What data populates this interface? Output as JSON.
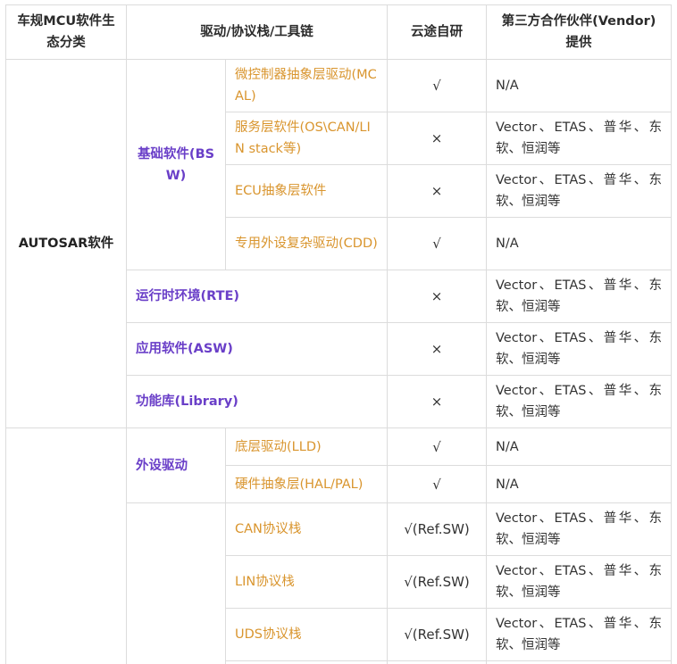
{
  "headers": {
    "category": "车规MCU软件生态分类",
    "driver": "驱动/协议栈/工具链",
    "yuntu": "云途自研",
    "vendor": "第三方合作伙伴(Vendor)提供"
  },
  "autosar": {
    "label": "AUTOSAR软件",
    "bsw": {
      "label": "基础软件(BSW)",
      "rows": [
        {
          "name": "微控制器抽象层驱动(MCAL)",
          "mark": "√",
          "vendor": "N/A"
        },
        {
          "name": "服务层软件(OS\\CAN/LIN stack等)",
          "mark": "×",
          "vendor": "Vector、ETAS、普华、东软、恒润等"
        },
        {
          "name": "ECU抽象层软件",
          "mark": "×",
          "vendor": "Vector、ETAS、普华、东软、恒润等"
        },
        {
          "name": "专用外设复杂驱动(CDD)",
          "mark": "√",
          "vendor": "N/A"
        }
      ]
    },
    "rows": [
      {
        "label": "运行时环境(RTE)",
        "mark": "×",
        "vendor": "Vector、ETAS、普华、东软、恒润等"
      },
      {
        "label": "应用软件(ASW)",
        "mark": "×",
        "vendor": "Vector、ETAS、普华、东软、恒润等"
      },
      {
        "label": "功能库(Library)",
        "mark": "×",
        "vendor": "Vector、ETAS、普华、东软、恒润等"
      }
    ]
  },
  "other": {
    "peripheral": {
      "label": "外设驱动",
      "rows": [
        {
          "name": "底层驱动(LLD)",
          "mark": "√",
          "vendor": "N/A"
        },
        {
          "name": "硬件抽象层(HAL/PAL)",
          "mark": "√",
          "vendor": "N/A"
        }
      ]
    },
    "stacks": [
      {
        "name": "CAN协议栈",
        "mark": "√(Ref.SW)",
        "vendor": "Vector、ETAS、普华、东软、恒润等"
      },
      {
        "name": "LIN协议栈",
        "mark": "√(Ref.SW)",
        "vendor": "Vector、ETAS、普华、东软、恒润等"
      },
      {
        "name": "UDS协议栈",
        "mark": "√(Ref.SW)",
        "vendor": "Vector、ETAS、普华、东软、恒润等"
      }
    ]
  }
}
